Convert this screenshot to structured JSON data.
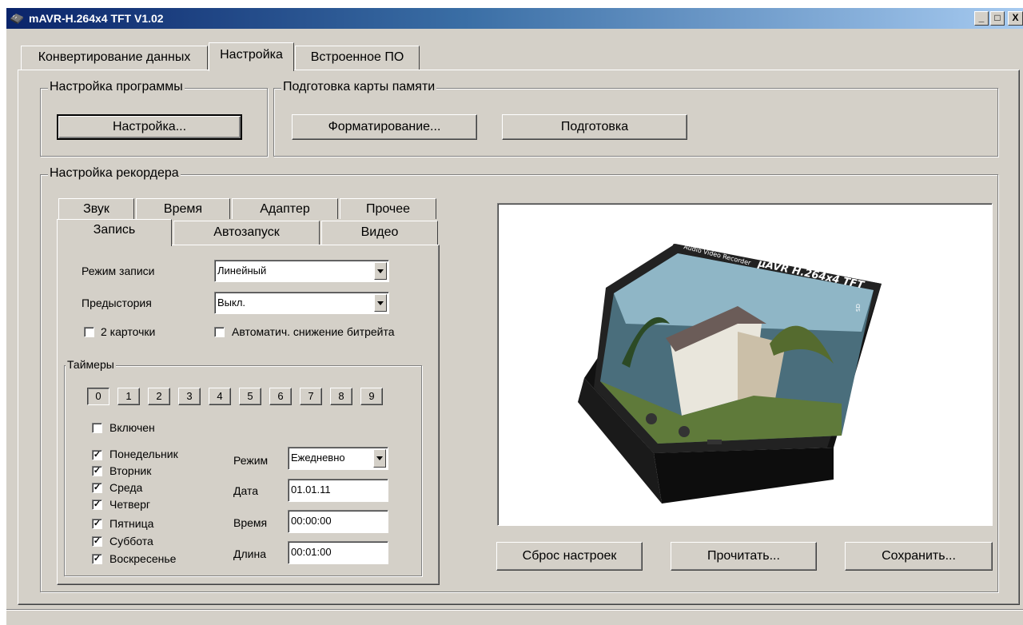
{
  "window": {
    "title": "mAVR-H.264x4 TFT V1.02",
    "controls": {
      "minimize": "_",
      "maximize": "□",
      "close": "X"
    }
  },
  "main_tabs": [
    {
      "label": "Конвертирование данных"
    },
    {
      "label": "Настройка",
      "active": true
    },
    {
      "label": "Встроенное ПО"
    }
  ],
  "program_settings": {
    "legend": "Настройка программы",
    "button_label": "Настройка..."
  },
  "card_prep": {
    "legend": "Подготовка карты памяти",
    "format_label": "Форматирование...",
    "prepare_label": "Подготовка"
  },
  "recorder": {
    "legend": "Настройка рекордера",
    "tabs_row1": [
      "Звук",
      "Время",
      "Адаптер",
      "Прочее"
    ],
    "tabs_row2": [
      "Запись",
      "Автозапуск",
      "Видео"
    ],
    "active_tab": "Запись",
    "record_mode_label": "Режим записи",
    "record_mode_value": "Линейный",
    "prehistory_label": "Предыстория",
    "prehistory_value": "Выкл.",
    "two_cards_label": "2 карточки",
    "two_cards_checked": false,
    "auto_bitrate_label": "Автоматич. снижение битрейта",
    "auto_bitrate_checked": false
  },
  "timers": {
    "legend": "Таймеры",
    "numbers": [
      "0",
      "1",
      "2",
      "3",
      "4",
      "5",
      "6",
      "7",
      "8",
      "9"
    ],
    "selected": "0",
    "enabled_label": "Включен",
    "enabled_checked": false,
    "days": [
      {
        "label": "Понедельник",
        "checked": true
      },
      {
        "label": "Вторник",
        "checked": true
      },
      {
        "label": "Среда",
        "checked": true
      },
      {
        "label": "Четверг",
        "checked": true
      },
      {
        "label": "Пятница",
        "checked": true
      },
      {
        "label": "Суббота",
        "checked": true
      },
      {
        "label": "Воскресенье",
        "checked": true
      }
    ],
    "mode_label": "Режим",
    "mode_value": "Ежедневно",
    "date_label": "Дата",
    "date_value": "01.01.11",
    "time_label": "Время",
    "time_value": "00:00:00",
    "length_label": "Длина",
    "length_value": "00:01:00"
  },
  "device_image": {
    "brand_text": "µAVR H.264x4 TFT",
    "top_text": "Audio Video Recorder",
    "side_text": "SD"
  },
  "actions": {
    "reset_label": "Сброс настроек",
    "read_label": "Прочитать...",
    "save_label": "Сохранить..."
  }
}
